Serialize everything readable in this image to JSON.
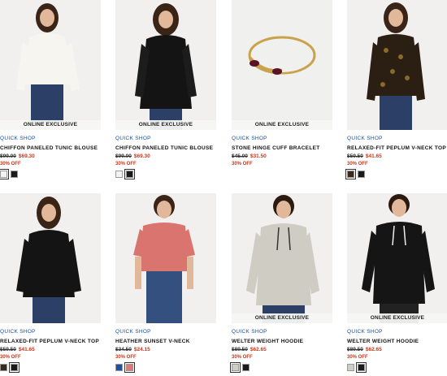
{
  "quick_shop_label": "QUICK SHOP",
  "online_exclusive_label": "ONLINE EXCLUSIVE",
  "products": [
    {
      "name": "CHIFFON PANELED TUNIC BLOUSE",
      "orig": "$99.00",
      "sale": "$69.30",
      "discount": "30% OFF",
      "online_exclusive": true,
      "swatches": [
        "#f5f3ee",
        "#1a1a1a"
      ]
    },
    {
      "name": "CHIFFON PANELED TUNIC BLOUSE",
      "orig": "$99.00",
      "sale": "$69.30",
      "discount": "30% OFF",
      "online_exclusive": true,
      "swatches": [
        "#f5f3ee",
        "#1a1a1a"
      ]
    },
    {
      "name": "STONE HINGE CUFF BRACELET",
      "orig": "$45.00",
      "sale": "$31.50",
      "discount": "30% OFF",
      "online_exclusive": true,
      "swatches": []
    },
    {
      "name": "RELAXED-FIT PEPLUM V-NECK TOP",
      "orig": "$59.50",
      "sale": "$41.65",
      "discount": "30% OFF",
      "online_exclusive": false,
      "swatches": [
        "#3b2a1a",
        "#1a1a1a"
      ]
    },
    {
      "name": "RELAXED-FIT PEPLUM V-NECK TOP",
      "orig": "$59.50",
      "sale": "$41.65",
      "discount": "30% OFF",
      "online_exclusive": false,
      "swatches": [
        "#3b2a1a",
        "#1a1a1a"
      ]
    },
    {
      "name": "HEATHER SUNSET V-NECK",
      "orig": "$34.50",
      "sale": "$24.15",
      "discount": "30% OFF",
      "online_exclusive": false,
      "swatches": [
        "#1f4fa8",
        "#d97a78"
      ]
    },
    {
      "name": "WELTER WEIGHT HOODIE",
      "orig": "$89.50",
      "sale": "$62.65",
      "discount": "30% OFF",
      "online_exclusive": true,
      "swatches": [
        "#cfccc4",
        "#1a1a1a"
      ]
    },
    {
      "name": "WELTER WEIGHT HOODIE",
      "orig": "$89.50",
      "sale": "$62.65",
      "discount": "30% OFF",
      "online_exclusive": true,
      "swatches": [
        "#cfccc4",
        "#1a1a1a"
      ]
    }
  ],
  "colors": {
    "link": "#1a4fa0",
    "sale": "#c8361b"
  }
}
